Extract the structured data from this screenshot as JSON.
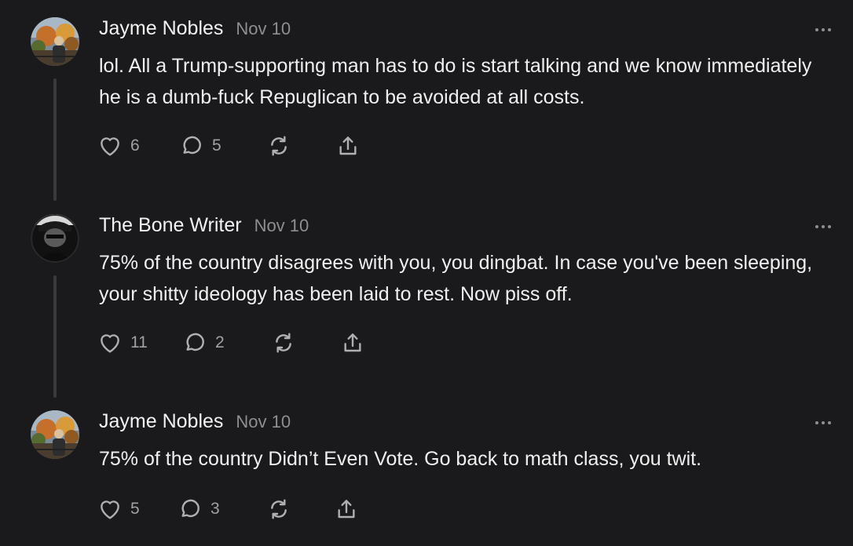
{
  "comments": [
    {
      "author": "Jayme Nobles",
      "date": "Nov 10",
      "text": "lol. All a Trump-supporting man has to do is start talking and we know immediately he is a dumb-fuck Repuglican to be avoided at all costs.",
      "likes": "6",
      "replies": "5",
      "avatar": "autumn-landscape-photo"
    },
    {
      "author": "The Bone Writer",
      "date": "Nov 10",
      "text": "75% of the country disagrees with you, you dingbat. In case you've been sleeping, your shitty ideology has been laid to rest. Now piss off.",
      "likes": "11",
      "replies": "2",
      "avatar": "dark-hooded-figure-photo"
    },
    {
      "author": "Jayme Nobles",
      "date": "Nov 10",
      "text": "75% of the country Didn’t Even Vote. Go back to math class, you twit.",
      "likes": "5",
      "replies": "3",
      "avatar": "autumn-landscape-photo"
    }
  ],
  "icons": {
    "like": "heart-icon",
    "reply": "comment-icon",
    "restack": "restack-icon",
    "share": "share-icon",
    "more": "more-options-icon"
  },
  "colors": {
    "background": "#1a1a1c",
    "text": "#f0f0f0",
    "muted": "#8f8f93",
    "icon": "#b0b0b4",
    "thread_line": "#3a3a3c"
  }
}
